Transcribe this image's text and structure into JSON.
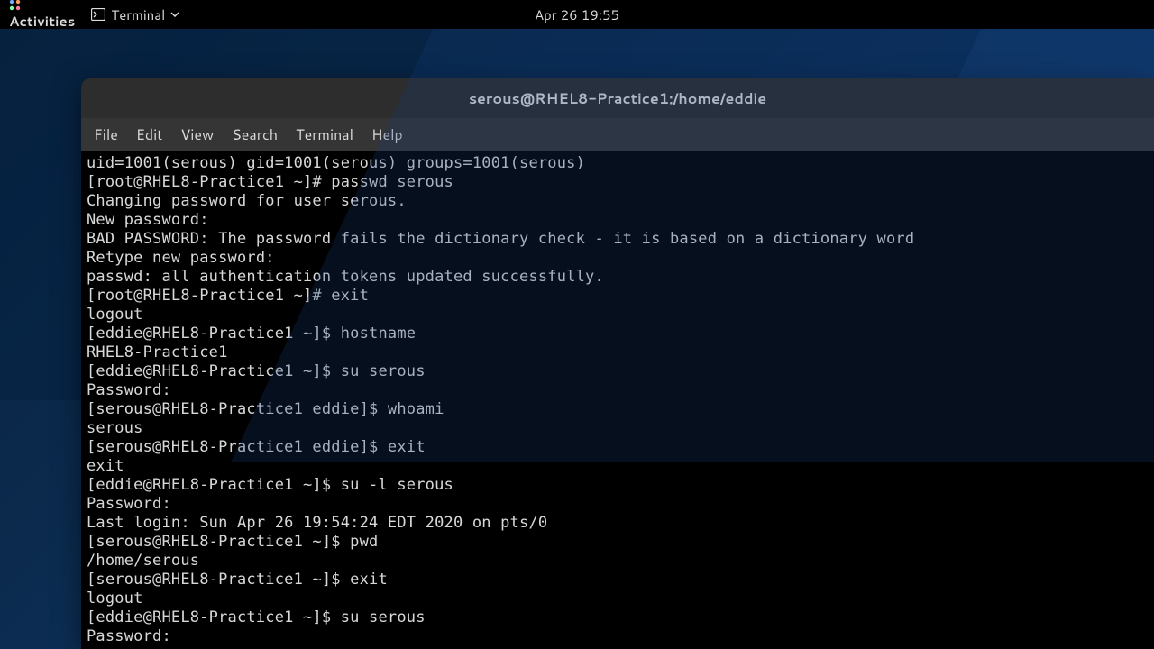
{
  "topbar": {
    "activities": "Activities",
    "app_name": "Terminal",
    "clock": "Apr 26  19:55"
  },
  "window": {
    "title": "serous@RHEL8-Practice1:/home/eddie"
  },
  "menubar": {
    "file": "File",
    "edit": "Edit",
    "view": "View",
    "search": "Search",
    "terminal": "Terminal",
    "help": "Help"
  },
  "terminal": {
    "lines": [
      "uid=1001(serous) gid=1001(serous) groups=1001(serous)",
      "[root@RHEL8-Practice1 ~]# passwd serous",
      "Changing password for user serous.",
      "New password:",
      "BAD PASSWORD: The password fails the dictionary check - it is based on a dictionary word",
      "Retype new password:",
      "passwd: all authentication tokens updated successfully.",
      "[root@RHEL8-Practice1 ~]# exit",
      "logout",
      "[eddie@RHEL8-Practice1 ~]$ hostname",
      "RHEL8-Practice1",
      "[eddie@RHEL8-Practice1 ~]$ su serous",
      "Password:",
      "[serous@RHEL8-Practice1 eddie]$ whoami",
      "serous",
      "[serous@RHEL8-Practice1 eddie]$ exit",
      "exit",
      "[eddie@RHEL8-Practice1 ~]$ su -l serous",
      "Password:",
      "Last login: Sun Apr 26 19:54:24 EDT 2020 on pts/0",
      "[serous@RHEL8-Practice1 ~]$ pwd",
      "/home/serous",
      "[serous@RHEL8-Practice1 ~]$ exit",
      "logout",
      "[eddie@RHEL8-Practice1 ~]$ su serous",
      "Password:"
    ]
  }
}
